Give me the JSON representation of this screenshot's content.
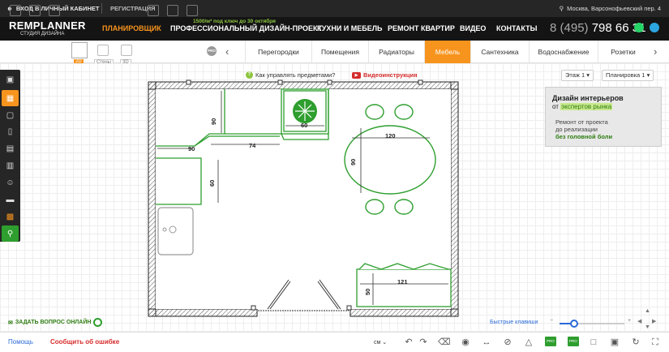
{
  "topbar": {
    "login": "ВХОД В ЛИЧНЫЙ КАБИНЕТ",
    "register": "РЕГИСТРАЦИЯ",
    "location": "Москва, Варсонофьевский пер. 4"
  },
  "header": {
    "logo_main": "REMPLANNER",
    "logo_sub": "СТУДИЯ ДИЗАЙНА",
    "nav_active": "ПЛАНИРОВЩИК",
    "promo": "1500/м² под ключ до 30 октября",
    "nav": [
      "ПРОФЕССИОНАЛЬНЫЙ ДИЗАЙН-ПРОЕКТ",
      "КУХНИ И МЕБЕЛЬ",
      "РЕМОНТ КВАРТИР",
      "ВИДЕО",
      "КОНТАКТЫ"
    ],
    "phone_prefix": "8 (495)",
    "phone_number": "798 66 31"
  },
  "toolbar": {
    "view_2d": "2D",
    "view_walls": "Стены",
    "view_3d": "3D",
    "pro_label": "PRO"
  },
  "categories": [
    {
      "label": "Перегородки",
      "active": false
    },
    {
      "label": "Помещения",
      "active": false
    },
    {
      "label": "Радиаторы",
      "active": false
    },
    {
      "label": "Мебель",
      "active": true
    },
    {
      "label": "Сантехника",
      "active": false
    },
    {
      "label": "Водоснабжение",
      "active": false
    },
    {
      "label": "Розетки",
      "active": false
    }
  ],
  "canvas": {
    "help_text": "Как управлять предметами?",
    "video_text": "Видеоинструкция",
    "floor_select": "Этаж 1",
    "layout_select": "Планировка 1",
    "dims": {
      "d90_vertical": "90",
      "d90_horizontal": "90",
      "d74": "74",
      "d60_vertical": "60",
      "d60_fridge": "60",
      "d120": "120",
      "d90_table": "90",
      "d121": "121",
      "d50": "50"
    }
  },
  "ad": {
    "line1": "Дизайн интерьеров",
    "line2_prefix": "от",
    "line2_highlight": "экспертов рынка",
    "line3": "Ремонт от проекта",
    "line4": "до реализации",
    "line5": "без головной боли"
  },
  "footer": {
    "ask": "ЗАДАТЬ ВОПРОС ОНЛАЙН",
    "hotkeys": "Быстрые клавиши",
    "zoom_level": 0.22,
    "help": "Помощь",
    "report": "Сообщить об ошибке",
    "unit": "см",
    "pro_badge": "PRO"
  },
  "colors": {
    "accent": "#f7941d",
    "furniture": "#2e9e2e",
    "link": "#2a6ad8",
    "error": "#d62b2b"
  }
}
